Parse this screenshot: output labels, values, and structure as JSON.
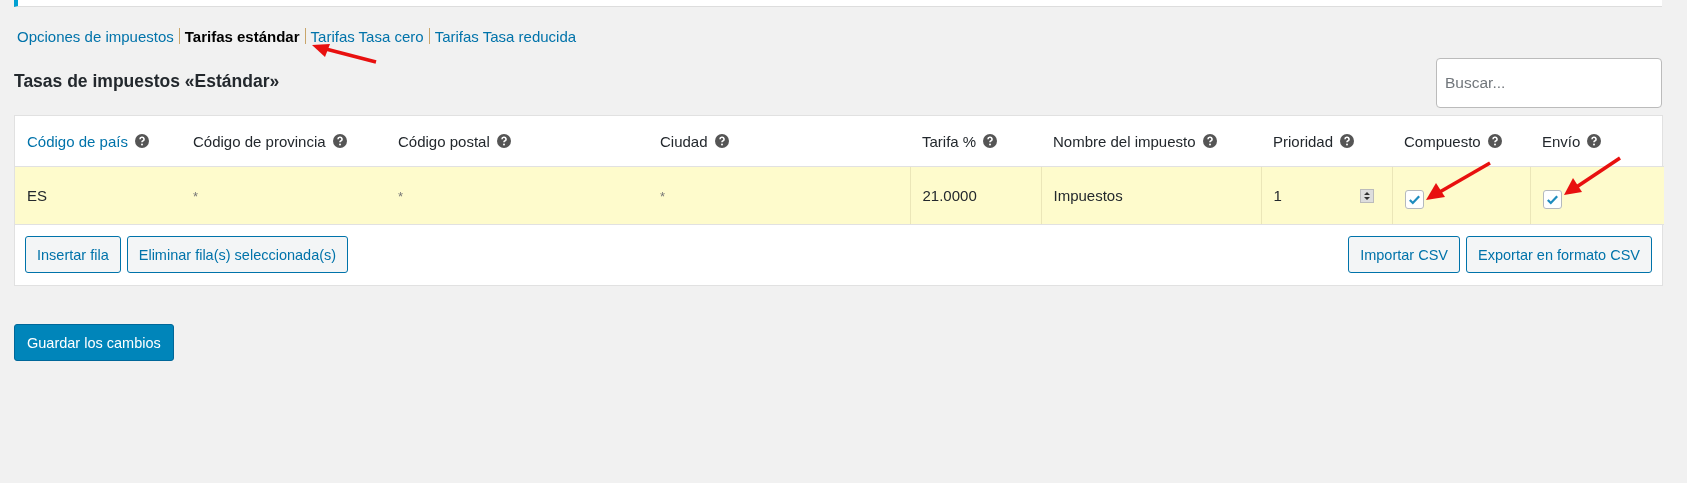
{
  "subnav": [
    {
      "label": "Opciones de impuestos",
      "selected": false
    },
    {
      "label": "Tarifas estándar",
      "selected": true
    },
    {
      "label": "Tarifas Tasa cero",
      "selected": false
    },
    {
      "label": "Tarifas Tasa reducida",
      "selected": false
    }
  ],
  "heading": "Tasas de impuestos «Estándar»",
  "search": {
    "placeholder": "Buscar..."
  },
  "table": {
    "columns": [
      {
        "label": "Código de país",
        "kind": "link"
      },
      {
        "label": "Código de provincia",
        "kind": "text"
      },
      {
        "label": "Código postal",
        "kind": "text"
      },
      {
        "label": "Ciudad",
        "kind": "text"
      },
      {
        "label": "Tarifa %",
        "kind": "text"
      },
      {
        "label": "Nombre del impuesto",
        "kind": "text"
      },
      {
        "label": "Prioridad",
        "kind": "text"
      },
      {
        "label": "Compuesto",
        "kind": "text"
      },
      {
        "label": "Envío",
        "kind": "text"
      }
    ],
    "rows": [
      {
        "selected": true,
        "country": "ES",
        "state": "*",
        "postcode": "*",
        "city": "*",
        "rate": "21.0000",
        "name": "Impuestos",
        "priority": "1",
        "compound": true,
        "shipping": true
      }
    ],
    "left_buttons": [
      "Insertar fila",
      "Eliminar fila(s) seleccionada(s)"
    ],
    "right_buttons": [
      "Importar CSV",
      "Exportar en formato CSV"
    ]
  },
  "save_button": "Guardar los cambios"
}
